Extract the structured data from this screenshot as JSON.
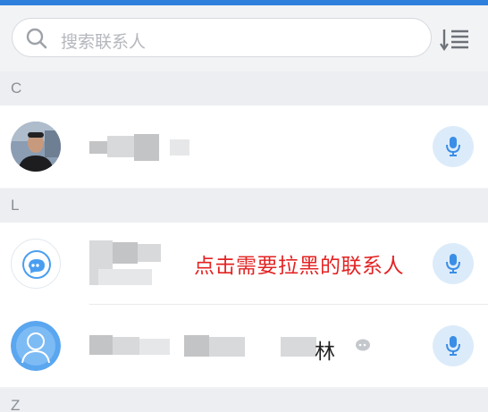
{
  "search": {
    "placeholder": "搜索联系人"
  },
  "sections": [
    {
      "letter": "C"
    },
    {
      "letter": "L"
    },
    {
      "letter": "Z"
    }
  ],
  "contacts": [
    {
      "section": "C",
      "avatar": "photo-avatar",
      "name_visible": ""
    },
    {
      "section": "L",
      "avatar": "message-bubble-avatar",
      "name_visible": ""
    },
    {
      "section": "L",
      "avatar": "default-person-avatar",
      "name_visible": "林"
    }
  ],
  "annotation": {
    "text": "点击需要拉黑的联系人",
    "color": "#e32323"
  },
  "colors": {
    "accent": "#2f7fdc",
    "mic_bg": "#dcebfa",
    "mic_icon": "#3a8ee6"
  },
  "icons": [
    "search-icon",
    "sort-icon",
    "microphone-icon",
    "message-bubble-icon",
    "person-silhouette-icon",
    "chat-bubble-icon"
  ]
}
